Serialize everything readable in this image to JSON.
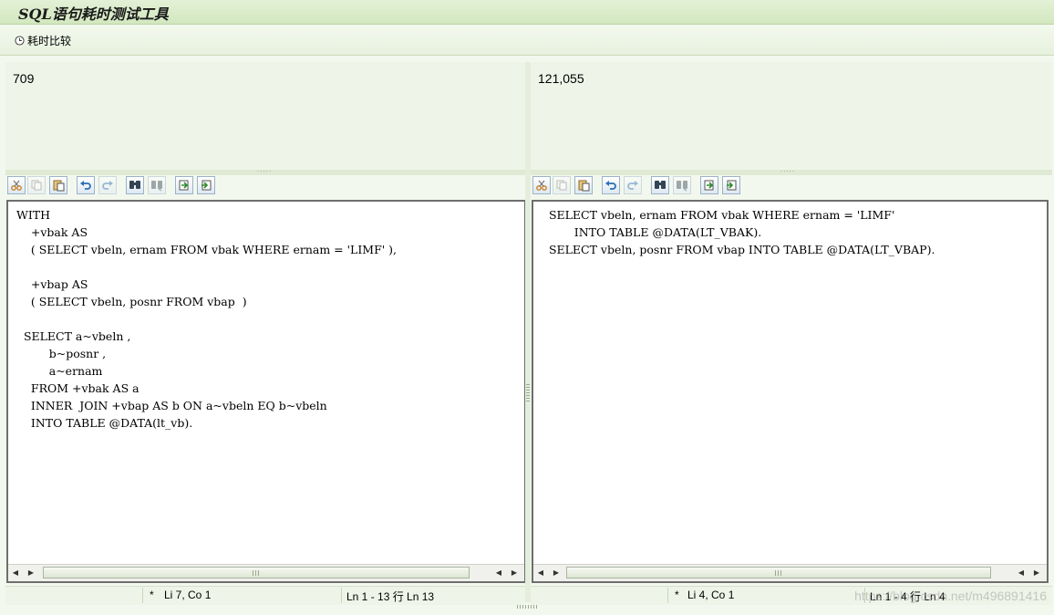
{
  "app": {
    "title": "SQL语句耗时测试工具"
  },
  "toolbar": {
    "compare_label": "耗时比较"
  },
  "left": {
    "result": "709",
    "code": "WITH\n    +vbak AS\n    ( SELECT vbeln, ernam FROM vbak WHERE ernam = 'LIMF' ),\n\n    +vbap AS\n    ( SELECT vbeln, posnr FROM vbap  )\n\n  SELECT a~vbeln ,\n         b~posnr ,\n         a~ernam\n    FROM +vbak AS a\n    INNER  JOIN +vbap AS b ON a~vbeln EQ b~vbeln\n    INTO TABLE @DATA(lt_vb).",
    "status": {
      "modified": "*",
      "position": "Li 7, Co 1",
      "range": "Ln 1 - 13 行 Ln 13"
    }
  },
  "right": {
    "result": "121,055",
    "code": "  SELECT vbeln, ernam FROM vbak WHERE ernam = 'LIMF'\n         INTO TABLE @DATA(LT_VBAK).\n  SELECT vbeln, posnr FROM vbap INTO TABLE @DATA(LT_VBAP).",
    "status": {
      "modified": "*",
      "position": "Li 4, Co 1",
      "range": "Ln 1 - 4 行 Ln 4"
    }
  },
  "watermark": "https://blog.csdn.net/m496891416",
  "editor_tools": [
    "cut-icon",
    "copy-icon",
    "paste-icon",
    "undo-icon",
    "redo-icon",
    "find-icon",
    "find-next-icon",
    "upload-icon",
    "download-icon"
  ]
}
